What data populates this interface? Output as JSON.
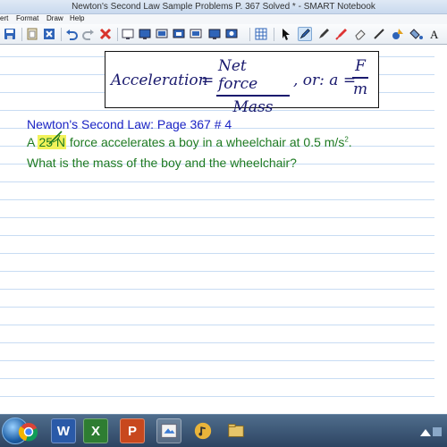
{
  "window": {
    "title": "Newton's Second Law Sample Problems P. 367 Solved * - SMART Notebook"
  },
  "menu": {
    "items": [
      "ert",
      "Format",
      "Draw",
      "Help"
    ]
  },
  "toolbar": {
    "icons": [
      "save-icon",
      "paste-icon",
      "delete-icon",
      "undo-icon",
      "redo-icon",
      "delete-x-icon",
      "screen-shade-icon",
      "document-camera-icon",
      "display-icon",
      "capture-icon",
      "full-screen-icon",
      "table-icon",
      "select-icon",
      "pen-icon",
      "creative-pen-icon",
      "eraser-icon",
      "line-icon",
      "shapes-icon",
      "fill-icon",
      "text-icon"
    ]
  },
  "formula": {
    "lhs": "Acceleration",
    "eq": "=",
    "num1": "Net force",
    "den1": "Mass",
    "or": ", or:  a =",
    "num2": "F",
    "den2": "m"
  },
  "content": {
    "heading": "Newton's Second Law: Page 367 # 4",
    "line1_pre": "A ",
    "line1_highlight": "25 N",
    "line1_post": " force accelerates a boy in a wheelchair at 0.5 m/s",
    "line1_sup": "2",
    "line1_end": ".",
    "line2": "What is the mass of the boy and the wheelchair?"
  },
  "taskbar": {
    "apps": [
      "chrome-icon",
      "word-icon",
      "excel-icon",
      "powerpoint-icon",
      "smart-notebook-icon",
      "music-icon",
      "explorer-icon"
    ],
    "word_label": "W",
    "excel_label": "X",
    "ppt_label": "P"
  },
  "colors": {
    "heading": "#1b24c4",
    "body_text": "#1e7a22",
    "highlight": "#f2f25a",
    "formula": "#1a1a6e",
    "rule_lines": "#c8dcf3"
  }
}
